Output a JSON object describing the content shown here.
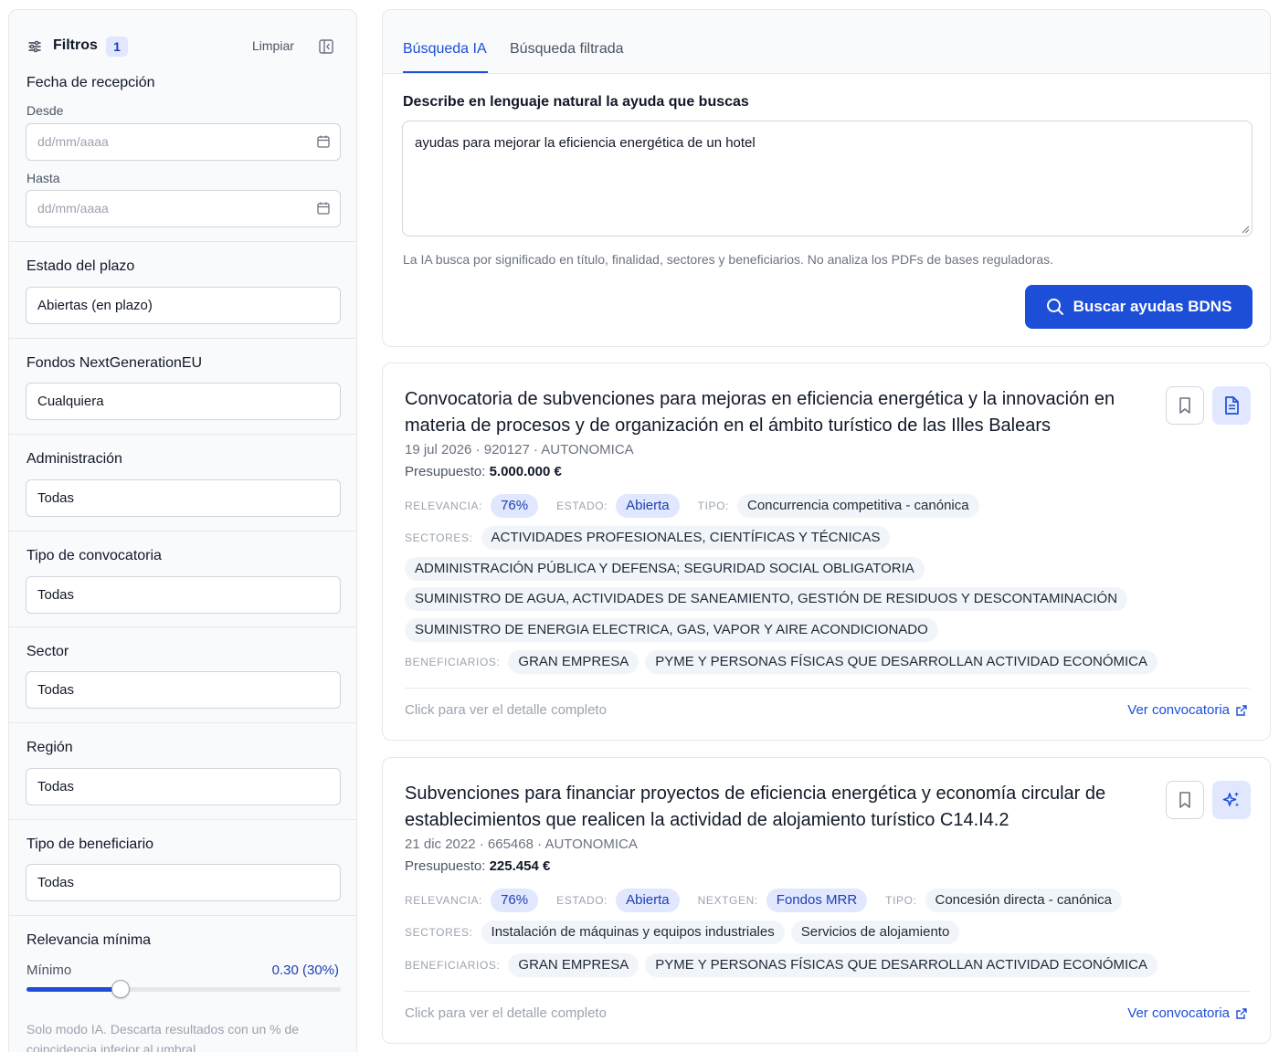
{
  "sidebar": {
    "title": "Filtros",
    "active_count": "1",
    "clear_label": "Limpiar",
    "date": {
      "label": "Fecha de recepción",
      "from_label": "Desde",
      "from_placeholder": "dd/mm/aaaa",
      "to_label": "Hasta",
      "to_placeholder": "dd/mm/aaaa"
    },
    "deadline": {
      "label": "Estado del plazo",
      "value": "Abiertas (en plazo)"
    },
    "nextgen": {
      "label": "Fondos NextGenerationEU",
      "value": "Cualquiera"
    },
    "administration": {
      "label": "Administración",
      "value": "Todas"
    },
    "call_type": {
      "label": "Tipo de convocatoria",
      "value": "Todas"
    },
    "sector": {
      "label": "Sector",
      "value": "Todas"
    },
    "region": {
      "label": "Región",
      "value": "Todas"
    },
    "beneficiary": {
      "label": "Tipo de beneficiario",
      "value": "Todas"
    },
    "relevance": {
      "label": "Relevancia mínima",
      "min_label": "Mínimo",
      "value_text": "0.30 (30%)",
      "value": 0.3,
      "help": "Solo modo IA. Descarta resultados con un % de coincidencia inferior al umbral."
    }
  },
  "search": {
    "tabs": [
      "Búsqueda IA",
      "Búsqueda filtrada"
    ],
    "active_tab": "Búsqueda IA",
    "prompt_label": "Describe en lenguaje natural la ayuda que buscas",
    "query": "ayudas para mejorar la eficiencia energética de un hotel",
    "hint": "La IA busca por significado en título, finalidad, sectores y beneficiarios. No analiza los PDFs de bases reguladoras.",
    "button_label": "Buscar ayudas BDNS"
  },
  "results": [
    {
      "title": "Convocatoria de subvenciones para mejoras en eficiencia energética y la innovación en materia de procesos y de organización en el ámbito turístico de las Illes Balears",
      "meta": "19 jul 2026 · 920127 · AUTONOMICA",
      "budget_label": "Presupuesto:",
      "budget": "5.000.000 €",
      "relevance_key": "RELEVANCIA:",
      "relevance": "76%",
      "status_key": "ESTADO:",
      "status": "Abierta",
      "type_key": "TIPO:",
      "type": "Concurrencia competitiva - canónica",
      "sectors_key": "SECTORES:",
      "sectors": [
        "ACTIVIDADES PROFESIONALES, CIENTÍFICAS Y TÉCNICAS",
        "ADMINISTRACIÓN PÚBLICA Y DEFENSA; SEGURIDAD SOCIAL OBLIGATORIA",
        "SUMINISTRO DE AGUA, ACTIVIDADES DE SANEAMIENTO, GESTIÓN DE RESIDUOS Y DESCONTAMINACIÓN",
        "SUMINISTRO DE ENERGIA ELECTRICA, GAS, VAPOR Y AIRE ACONDICIONADO"
      ],
      "beneficiaries_key": "BENEFICIARIOS:",
      "beneficiaries": [
        "GRAN EMPRESA",
        "PYME Y PERSONAS FÍSICAS QUE DESARROLLAN ACTIVIDAD ECONÓMICA"
      ],
      "footer_hint": "Click para ver el detalle completo",
      "link_label": "Ver convocatoria",
      "secondary_icon": "document-icon"
    },
    {
      "title": "Subvenciones para financiar proyectos de eficiencia energética y economía circular de establecimientos que realicen la actividad de alojamiento turístico C14.I4.2",
      "meta": "21 dic 2022 · 665468 · AUTONOMICA",
      "budget_label": "Presupuesto:",
      "budget": "225.454 €",
      "relevance_key": "RELEVANCIA:",
      "relevance": "76%",
      "status_key": "ESTADO:",
      "status": "Abierta",
      "nextgen_key": "NEXTGEN:",
      "nextgen": "Fondos MRR",
      "type_key": "TIPO:",
      "type": "Concesión directa - canónica",
      "sectors_key": "SECTORES:",
      "sectors": [
        "Instalación de máquinas y equipos industriales",
        "Servicios de alojamiento"
      ],
      "beneficiaries_key": "BENEFICIARIOS:",
      "beneficiaries": [
        "GRAN EMPRESA",
        "PYME Y PERSONAS FÍSICAS QUE DESARROLLAN ACTIVIDAD ECONÓMICA"
      ],
      "footer_hint": "Click para ver el detalle completo",
      "link_label": "Ver convocatoria",
      "secondary_icon": "sparkles-icon"
    }
  ],
  "colors": {
    "accent": "#1d4ed8",
    "accent_soft": "#e0e7ff",
    "tag_bg": "#f1f5f9"
  }
}
